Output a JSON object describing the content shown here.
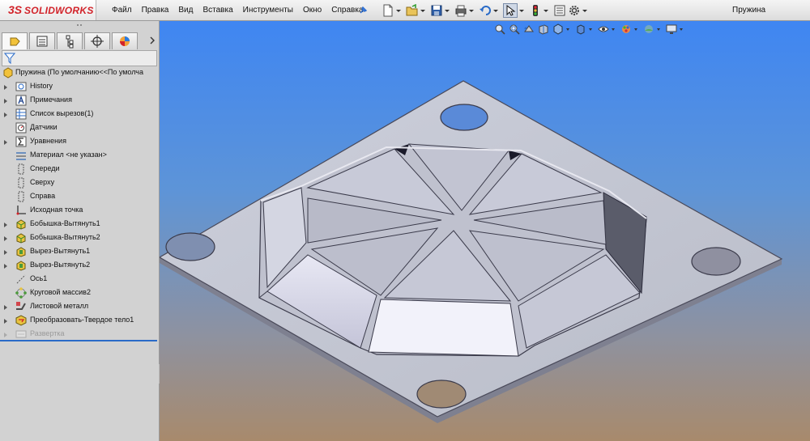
{
  "app": {
    "logo_ds": "3S",
    "logo_text": "SOLIDWORKS",
    "document_title": "Пружина"
  },
  "menu": [
    "Файл",
    "Правка",
    "Вид",
    "Вставка",
    "Инструменты",
    "Окно",
    "Справка"
  ],
  "toolbar_icons": [
    "new-document-icon",
    "open-icon",
    "save-icon",
    "print-icon",
    "undo-icon",
    "select-icon",
    "traffic-light-icon",
    "file-properties-icon",
    "gear-icon"
  ],
  "heads_up_icons": [
    "zoom-to-fit-icon",
    "zoom-area-icon",
    "previous-view-icon",
    "section-view-icon",
    "view-orientation-icon",
    "display-style-icon",
    "hide-show-icon",
    "edit-appearance-icon",
    "apply-scene-icon",
    "view-settings-icon"
  ],
  "panel_tabs": [
    "feature-manager-tab",
    "property-manager-tab",
    "configuration-manager-tab",
    "dimxpert-tab",
    "display-manager-tab"
  ],
  "tree": {
    "root": "Пружина  (По умолчанию<<По умолча",
    "items": [
      {
        "label": "History",
        "icon": "history-icon",
        "expandable": true
      },
      {
        "label": "Примечания",
        "icon": "annotations-icon",
        "expandable": true
      },
      {
        "label": "Список вырезов(1)",
        "icon": "cut-list-icon",
        "expandable": true
      },
      {
        "label": "Датчики",
        "icon": "sensors-icon",
        "expandable": false
      },
      {
        "label": "Уравнения",
        "icon": "equations-icon",
        "expandable": true
      },
      {
        "label": "Материал <не указан>",
        "icon": "material-icon",
        "expandable": false
      },
      {
        "label": "Спереди",
        "icon": "plane-icon",
        "expandable": false
      },
      {
        "label": "Сверху",
        "icon": "plane-icon",
        "expandable": false
      },
      {
        "label": "Справа",
        "icon": "plane-icon",
        "expandable": false
      },
      {
        "label": "Исходная точка",
        "icon": "origin-icon",
        "expandable": false
      },
      {
        "label": "Бобышка-Вытянуть1",
        "icon": "boss-extrude-icon",
        "expandable": true
      },
      {
        "label": "Бобышка-Вытянуть2",
        "icon": "boss-extrude-icon",
        "expandable": true
      },
      {
        "label": "Вырез-Вытянуть1",
        "icon": "cut-extrude-icon",
        "expandable": true
      },
      {
        "label": "Вырез-Вытянуть2",
        "icon": "cut-extrude-icon",
        "expandable": true
      },
      {
        "label": "Ось1",
        "icon": "axis-icon",
        "expandable": false
      },
      {
        "label": "Круговой массив2",
        "icon": "circular-pattern-icon",
        "expandable": false
      },
      {
        "label": "Листовой металл",
        "icon": "sheet-metal-icon",
        "expandable": true
      },
      {
        "label": "Преобразовать-Твердое тело1",
        "icon": "convert-solid-icon",
        "expandable": true
      },
      {
        "label": "Развертка",
        "icon": "flat-pattern-icon",
        "expandable": true,
        "suppressed": true
      }
    ]
  },
  "colors": {
    "brand": "#d2232a",
    "viewport_top": "#3f86f2",
    "viewport_bottom": "#a88a6c",
    "part": "#c8c8d8",
    "tree_rollback": "#2a6bc8"
  }
}
